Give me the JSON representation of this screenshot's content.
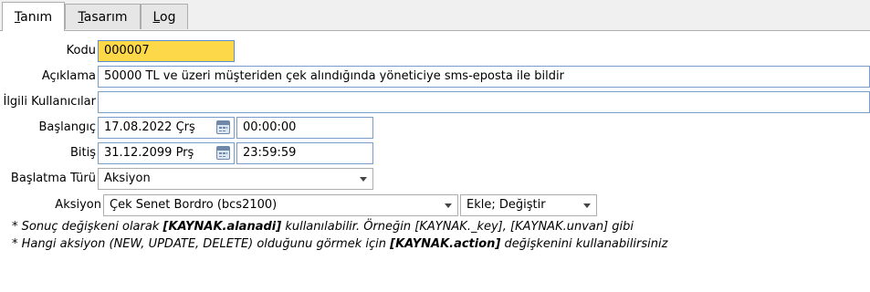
{
  "tabs": [
    {
      "label_ul": "T",
      "label_rest": "anım"
    },
    {
      "label_ul": "T",
      "label_rest": "asarım"
    },
    {
      "label_ul": "L",
      "label_rest": "og"
    }
  ],
  "form": {
    "kodu": {
      "label": "Kodu",
      "value": "000007"
    },
    "aciklama": {
      "label": "Açıklama",
      "value": "50000 TL ve üzeri müşteriden çek alındığında yöneticiye sms-eposta ile bildir"
    },
    "ilgili": {
      "label": "İlgili Kullanıcılar",
      "value": ""
    },
    "baslangic": {
      "label": "Başlangıç",
      "date": "17.08.2022 Çrş",
      "time": "00:00:00"
    },
    "bitis": {
      "label": "Bitiş",
      "date": "31.12.2099 Prş",
      "time": "23:59:59"
    },
    "baslatma_turu": {
      "label": "Başlatma Türü",
      "value": "Aksiyon"
    },
    "aksiyon": {
      "label": "Aksiyon",
      "value": "Çek Senet Bordro (bcs2100)",
      "mode": "Ekle; Değiştir"
    }
  },
  "notes": {
    "line1_a": "* Sonuç değişkeni olarak ",
    "line1_b": "[KAYNAK.alanadi]",
    "line1_c": " kullanılabilir. Örneğin [KAYNAK._key], [KAYNAK.unvan] gibi",
    "line2_a": "* Hangi aksiyon (NEW, UPDATE, DELETE) olduğunu görmek için ",
    "line2_b": "[KAYNAK.action]",
    "line2_c": " değişkenini kullanabilirsiniz"
  },
  "icons": {
    "calendar": "calendar-icon",
    "dropdown": "chevron-down-icon"
  }
}
